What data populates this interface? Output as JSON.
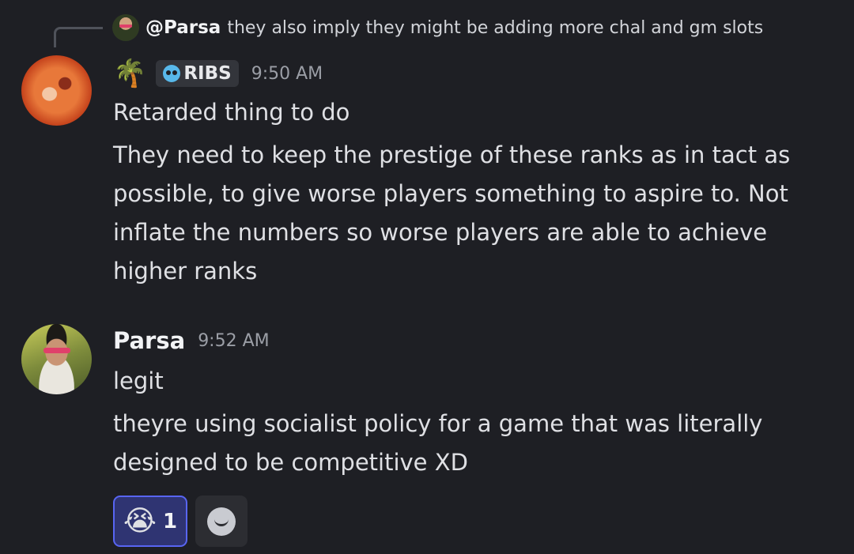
{
  "reply": {
    "author": "@Parsa",
    "text": "they also imply they might be adding more chal and gm slots"
  },
  "messages": [
    {
      "author_emoji": "🌴",
      "tag": "RIBS",
      "time": "9:50 AM",
      "lines": [
        "Retarded thing to do",
        "They need to keep the prestige of these ranks as in tact as",
        "possible, to give worse players something to aspire to. Not",
        "inflate the numbers so worse players are able to achieve",
        "higher ranks"
      ]
    },
    {
      "author": "Parsa",
      "time": "9:52 AM",
      "lines": [
        "legit",
        "theyre using socialist policy for a game that was literally",
        "designed to be competitive XD"
      ]
    }
  ],
  "reactions": [
    {
      "emoji": "😭",
      "count": "1"
    }
  ],
  "colors": {
    "background": "#1e1f24",
    "reaction_active_border": "#5865f2",
    "tag_icon": "#58b8ea"
  }
}
